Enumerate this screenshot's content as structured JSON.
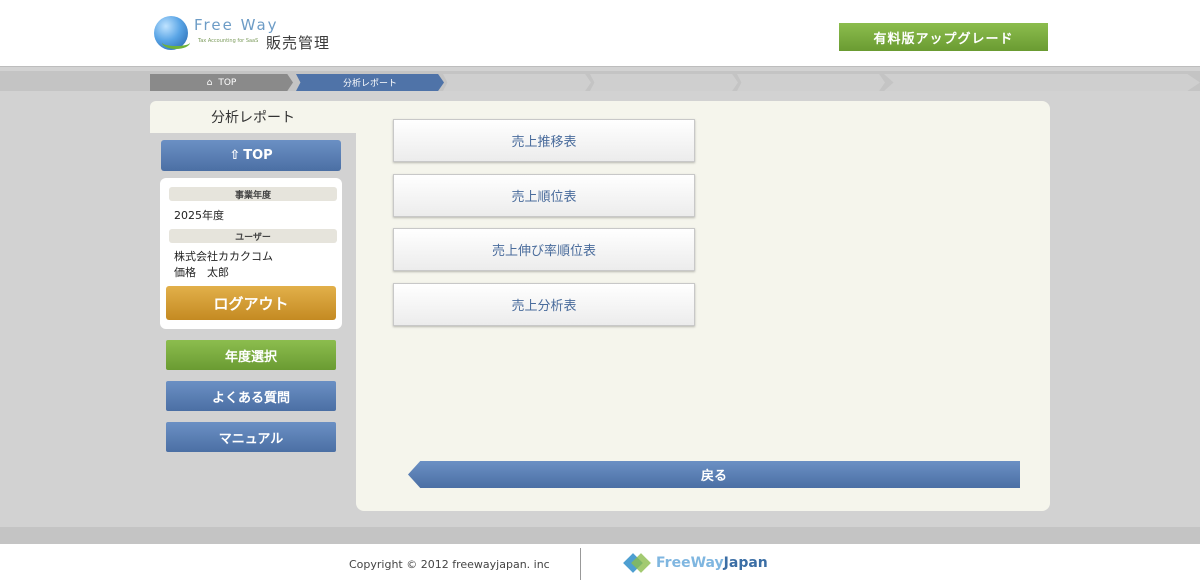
{
  "header": {
    "logo_freeway": "Free Way",
    "logo_tagline": "Tax Accounting for SaaS",
    "logo_product": "販売管理",
    "upgrade_label": "有料版アップグレード"
  },
  "breadcrumb": {
    "home_label": "TOP",
    "current_label": "分析レポート"
  },
  "sidebar": {
    "title": "分析レポート",
    "top_button": "TOP",
    "fiscal_year_heading": "事業年度",
    "fiscal_year_value": "2025年度",
    "user_heading": "ユーザー",
    "company_name": "株式会社カカクコム",
    "user_name": "価格　太郎",
    "logout_label": "ログアウト",
    "year_select_label": "年度選択",
    "faq_label": "よくある質問",
    "manual_label": "マニュアル"
  },
  "main": {
    "reports": [
      {
        "label": "売上推移表"
      },
      {
        "label": "売上順位表"
      },
      {
        "label": "売上伸び率順位表"
      },
      {
        "label": "売上分析表"
      }
    ],
    "back_label": "戻る"
  },
  "footer": {
    "copyright": "Copyright © 2012 freewayjapan. inc",
    "brand_free": "FreeWay",
    "brand_japan": "Japan"
  },
  "colors": {
    "accent_blue": "#4f73a8",
    "accent_green": "#7aab3f",
    "logout_orange": "#d49e36",
    "panel_bg": "#f5f5ec"
  }
}
